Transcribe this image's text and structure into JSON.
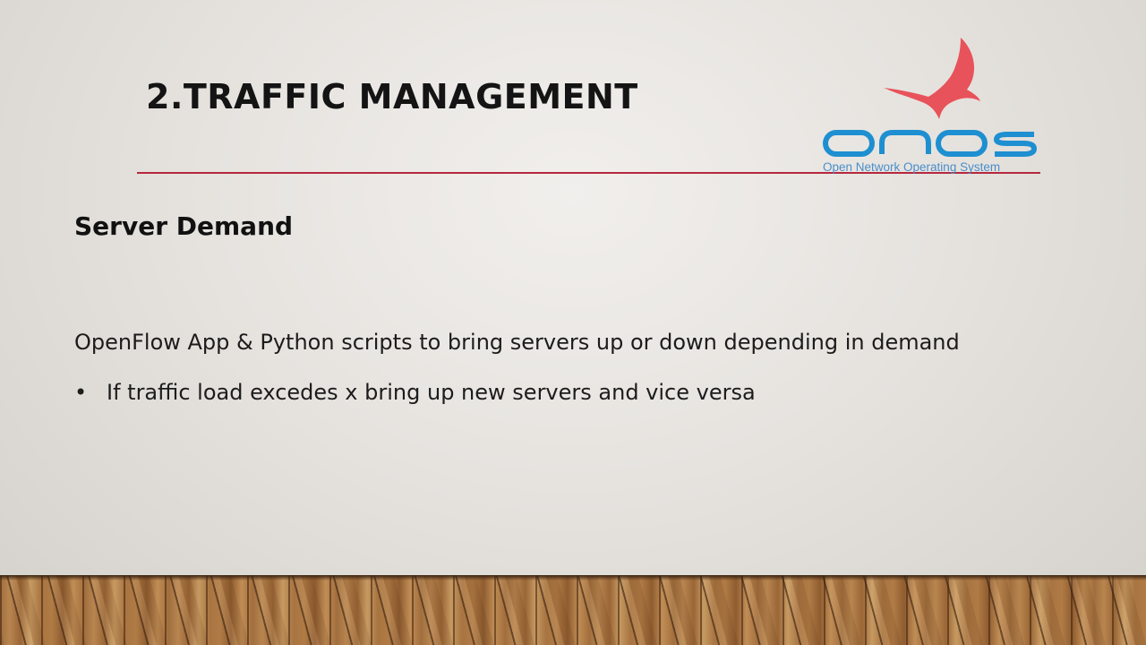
{
  "slide": {
    "title": "2.TRAFFIC MANAGEMENT",
    "subtitle": "Server Demand",
    "body_text": "OpenFlow App & Python scripts to bring servers up or down depending in demand",
    "bullets": [
      {
        "marker": "•",
        "text": "If traffic load excedes x bring up new servers and vice versa"
      }
    ]
  },
  "logo": {
    "wordmark": "onos",
    "tagline": "Open Network Operating System",
    "bird_color": "#e8525a",
    "wordmark_color": "#1e8fd0",
    "tagline_color": "#4a8ec9"
  },
  "colors": {
    "title_rule": "#b5283e",
    "floor": "#a87441"
  }
}
